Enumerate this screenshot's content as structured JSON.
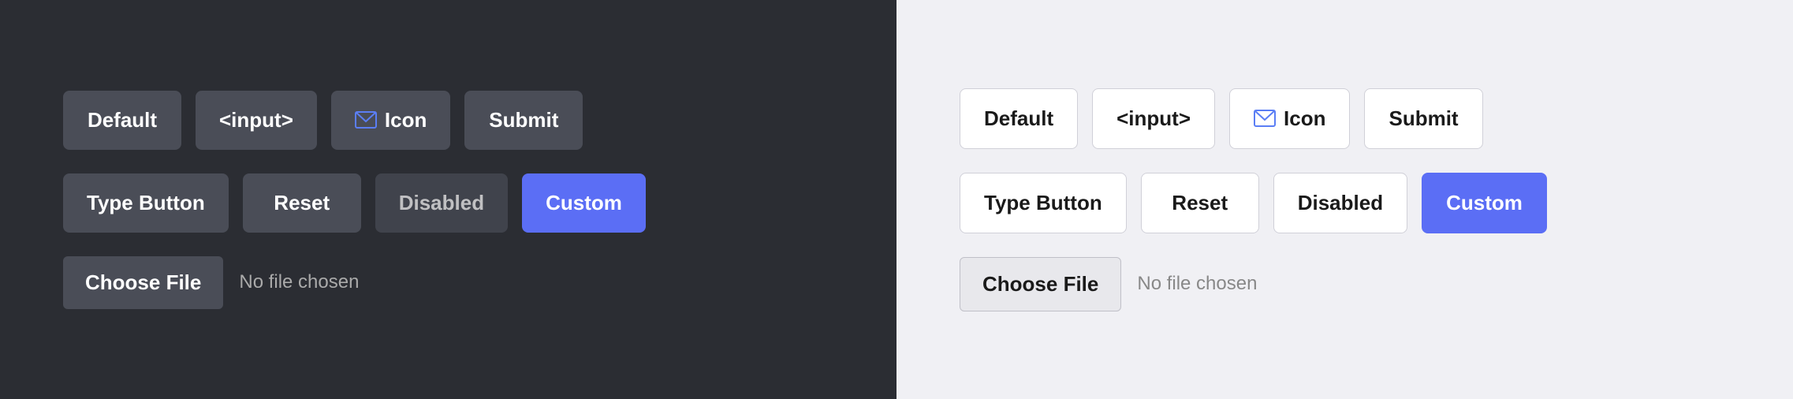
{
  "dark_panel": {
    "row1": {
      "btn1": "Default",
      "btn2": "<input>",
      "btn3_icon": "✉",
      "btn3_label": "Icon",
      "btn4": "Submit"
    },
    "row2": {
      "btn1": "Type Button",
      "btn2": "Reset",
      "btn3": "Disabled",
      "btn4": "Custom"
    },
    "file": {
      "button": "Choose File",
      "label": "No file chosen"
    }
  },
  "light_panel": {
    "row1": {
      "btn1": "Default",
      "btn2": "<input>",
      "btn3_icon": "✉",
      "btn3_label": "Icon",
      "btn4": "Submit"
    },
    "row2": {
      "btn1": "Type Button",
      "btn2": "Reset",
      "btn3": "Disabled",
      "btn4": "Custom"
    },
    "file": {
      "button": "Choose File",
      "label": "No file chosen"
    }
  }
}
